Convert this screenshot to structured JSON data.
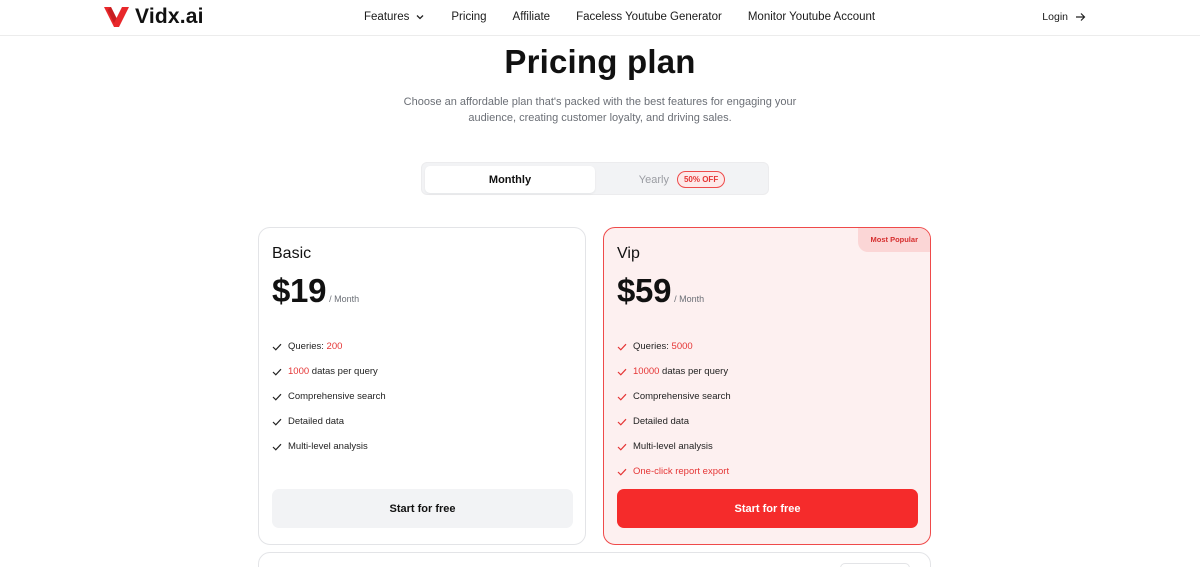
{
  "brand": {
    "name": "Vidx.ai",
    "logo_icon": "vidx-logo-icon",
    "accent_color": "#e53535"
  },
  "nav": {
    "items": [
      {
        "label": "Features",
        "has_dropdown": true
      },
      {
        "label": "Pricing"
      },
      {
        "label": "Affiliate"
      },
      {
        "label": "Faceless Youtube Generator"
      },
      {
        "label": "Monitor Youtube Account"
      }
    ],
    "login_label": "Login"
  },
  "hero": {
    "title": "Pricing plan",
    "subtitle": "Choose an affordable plan that's packed with the best features for engaging your audience, creating customer loyalty, and driving sales."
  },
  "billing_toggle": {
    "monthly_label": "Monthly",
    "yearly_label": "Yearly",
    "yearly_badge": "50% OFF",
    "selected": "Monthly"
  },
  "plans": [
    {
      "name": "Basic",
      "price": "$19",
      "period": "/ Month",
      "features": [
        {
          "prefix": "Queries: ",
          "highlight": "200",
          "suffix": ""
        },
        {
          "prefix": "",
          "highlight": "1000",
          "suffix": " datas per query"
        },
        {
          "prefix": "Comprehensive search",
          "highlight": "",
          "suffix": ""
        },
        {
          "prefix": "Detailed data",
          "highlight": "",
          "suffix": ""
        },
        {
          "prefix": "Multi-level analysis",
          "highlight": "",
          "suffix": ""
        }
      ],
      "cta": "Start for free"
    },
    {
      "name": "Vip",
      "badge": "Most Popular",
      "price": "$59",
      "period": "/ Month",
      "features": [
        {
          "prefix": "Queries: ",
          "highlight": "5000",
          "suffix": ""
        },
        {
          "prefix": "",
          "highlight": "10000",
          "suffix": " datas per query"
        },
        {
          "prefix": "Comprehensive search",
          "highlight": "",
          "suffix": ""
        },
        {
          "prefix": "Detailed data",
          "highlight": "",
          "suffix": ""
        },
        {
          "prefix": "Multi-level analysis",
          "highlight": "",
          "suffix": ""
        },
        {
          "prefix": "One-click report export",
          "highlight": "",
          "suffix": "",
          "all_red": true
        }
      ],
      "cta": "Start for free"
    }
  ]
}
